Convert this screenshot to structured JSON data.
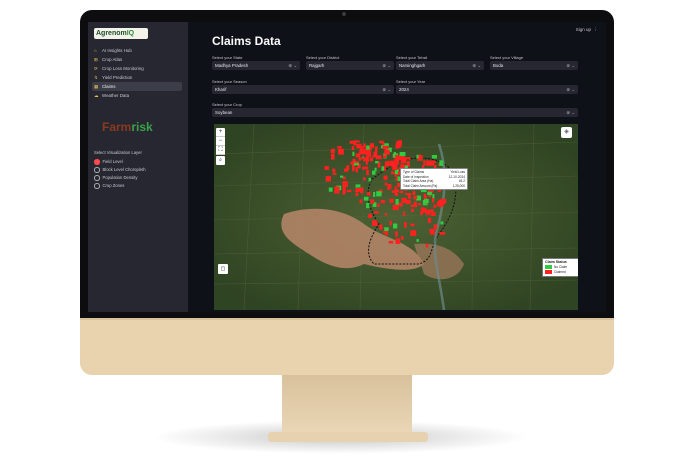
{
  "app": {
    "logo_text_a": "Agrenom",
    "logo_text_b": "IQ",
    "page_title": "Claims Data",
    "top_right_label": "Sign up"
  },
  "sidebar": {
    "items": [
      {
        "icon": "⌂",
        "label": "AI Insights Hub"
      },
      {
        "icon": "⊞",
        "label": "Crop Atlas"
      },
      {
        "icon": "⟳",
        "label": "Crop Loss Monitoring"
      },
      {
        "icon": "↯",
        "label": "Yield Prediction"
      },
      {
        "icon": "▦",
        "label": "Claims"
      },
      {
        "icon": "☁",
        "label": "Weather Data"
      }
    ],
    "active_index": 4,
    "brand_part1": "Farm",
    "brand_part2": "risk",
    "layer_title": "Select Visualization Layer",
    "layers": [
      "Field Level",
      "Block Level Choropleth",
      "Population Density",
      "Crop Zones"
    ],
    "selected_layer_index": 0
  },
  "filters": {
    "state": {
      "label": "Select your State",
      "value": "Madhya Pradesh"
    },
    "district": {
      "label": "Select your District",
      "value": "Rajgarh"
    },
    "tehsil": {
      "label": "Select your Tehsil",
      "value": "Narsinghgarh"
    },
    "village": {
      "label": "Select your Village",
      "value": "Boda"
    },
    "season": {
      "label": "Select your Season",
      "value": "Kharif"
    },
    "year": {
      "label": "Select your Year",
      "value": "2024"
    },
    "crop": {
      "label": "Select your Crop",
      "value": "Soybean"
    }
  },
  "map": {
    "tooltip": [
      {
        "k": "Type of Claims",
        "v": "Yield Loss"
      },
      {
        "k": "Date of Inspection",
        "v": "12-10-2024"
      },
      {
        "k": "Total Claim Area (Ha)",
        "v": "45.2"
      },
      {
        "k": "Total Claim Amount (Rs)",
        "v": "1,25,000"
      }
    ],
    "legend_title": "Claim Status",
    "legend_items": [
      {
        "label": "No Claim",
        "color": "#2ecc40"
      },
      {
        "label": "Claimed",
        "color": "#ff2020"
      }
    ],
    "zoom_in": "+",
    "zoom_out": "−",
    "fullscreen": "⛶",
    "search": "⌕",
    "draw": "▢",
    "layers_icon": "◈"
  }
}
